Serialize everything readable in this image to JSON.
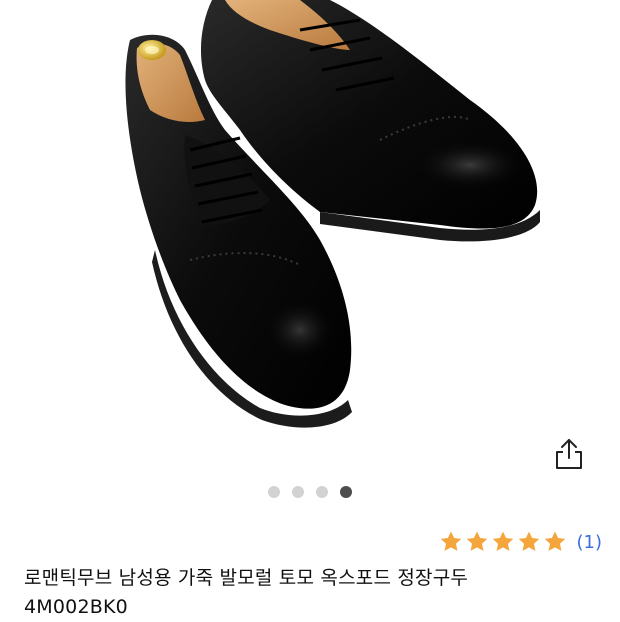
{
  "gallery": {
    "image_alt": "black leather cap-toe oxford shoes",
    "dots_total": 4,
    "active_index": 3
  },
  "rating": {
    "stars": 5,
    "max_stars": 5,
    "review_count": "(1)",
    "star_color": "#f4a63d"
  },
  "product": {
    "title_line1": "로맨틱무브 남성용 가죽 발모럴 토모 옥스포드 정장구두",
    "title_line2": "4M002BK0"
  },
  "icons": {
    "share": "share-icon",
    "star": "star-icon"
  }
}
